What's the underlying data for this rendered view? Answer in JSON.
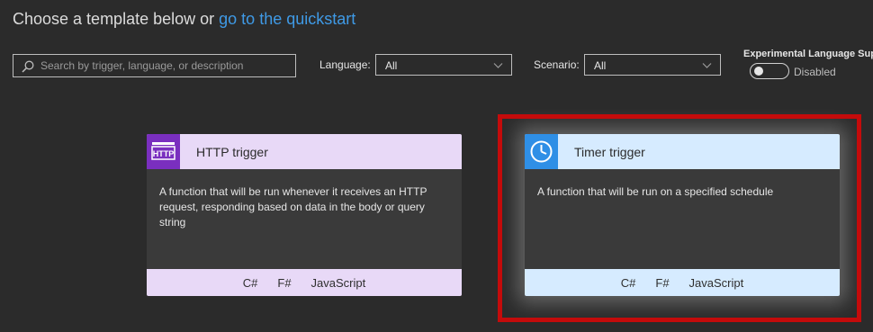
{
  "header": {
    "prefix": "Choose a template below or",
    "link": "go to the quickstart"
  },
  "search": {
    "placeholder": "Search by trigger, language, or description",
    "value": ""
  },
  "filters": {
    "language_label": "Language:",
    "language_value": "All",
    "scenario_label": "Scenario:",
    "scenario_value": "All"
  },
  "experimental": {
    "label": "Experimental Language Sup",
    "status": "Disabled"
  },
  "templates": [
    {
      "title": "HTTP trigger",
      "icon": "http-icon",
      "icon_text": "HTTP",
      "description": "A function that will be run whenever it receives an HTTP request, responding based on data in the body or query string",
      "languages": [
        "C#",
        "F#",
        "JavaScript"
      ]
    },
    {
      "title": "Timer trigger",
      "icon": "clock-icon",
      "description": "A function that will be run on a specified schedule",
      "languages": [
        "C#",
        "F#",
        "JavaScript"
      ]
    }
  ],
  "colors": {
    "link": "#3f9ae6",
    "http_header": "#e8d9f7",
    "http_icon_bg": "#7a2fbf",
    "timer_header": "#d6ebff",
    "timer_icon_bg": "#2f8fe6",
    "highlight": "#c40b0b"
  }
}
